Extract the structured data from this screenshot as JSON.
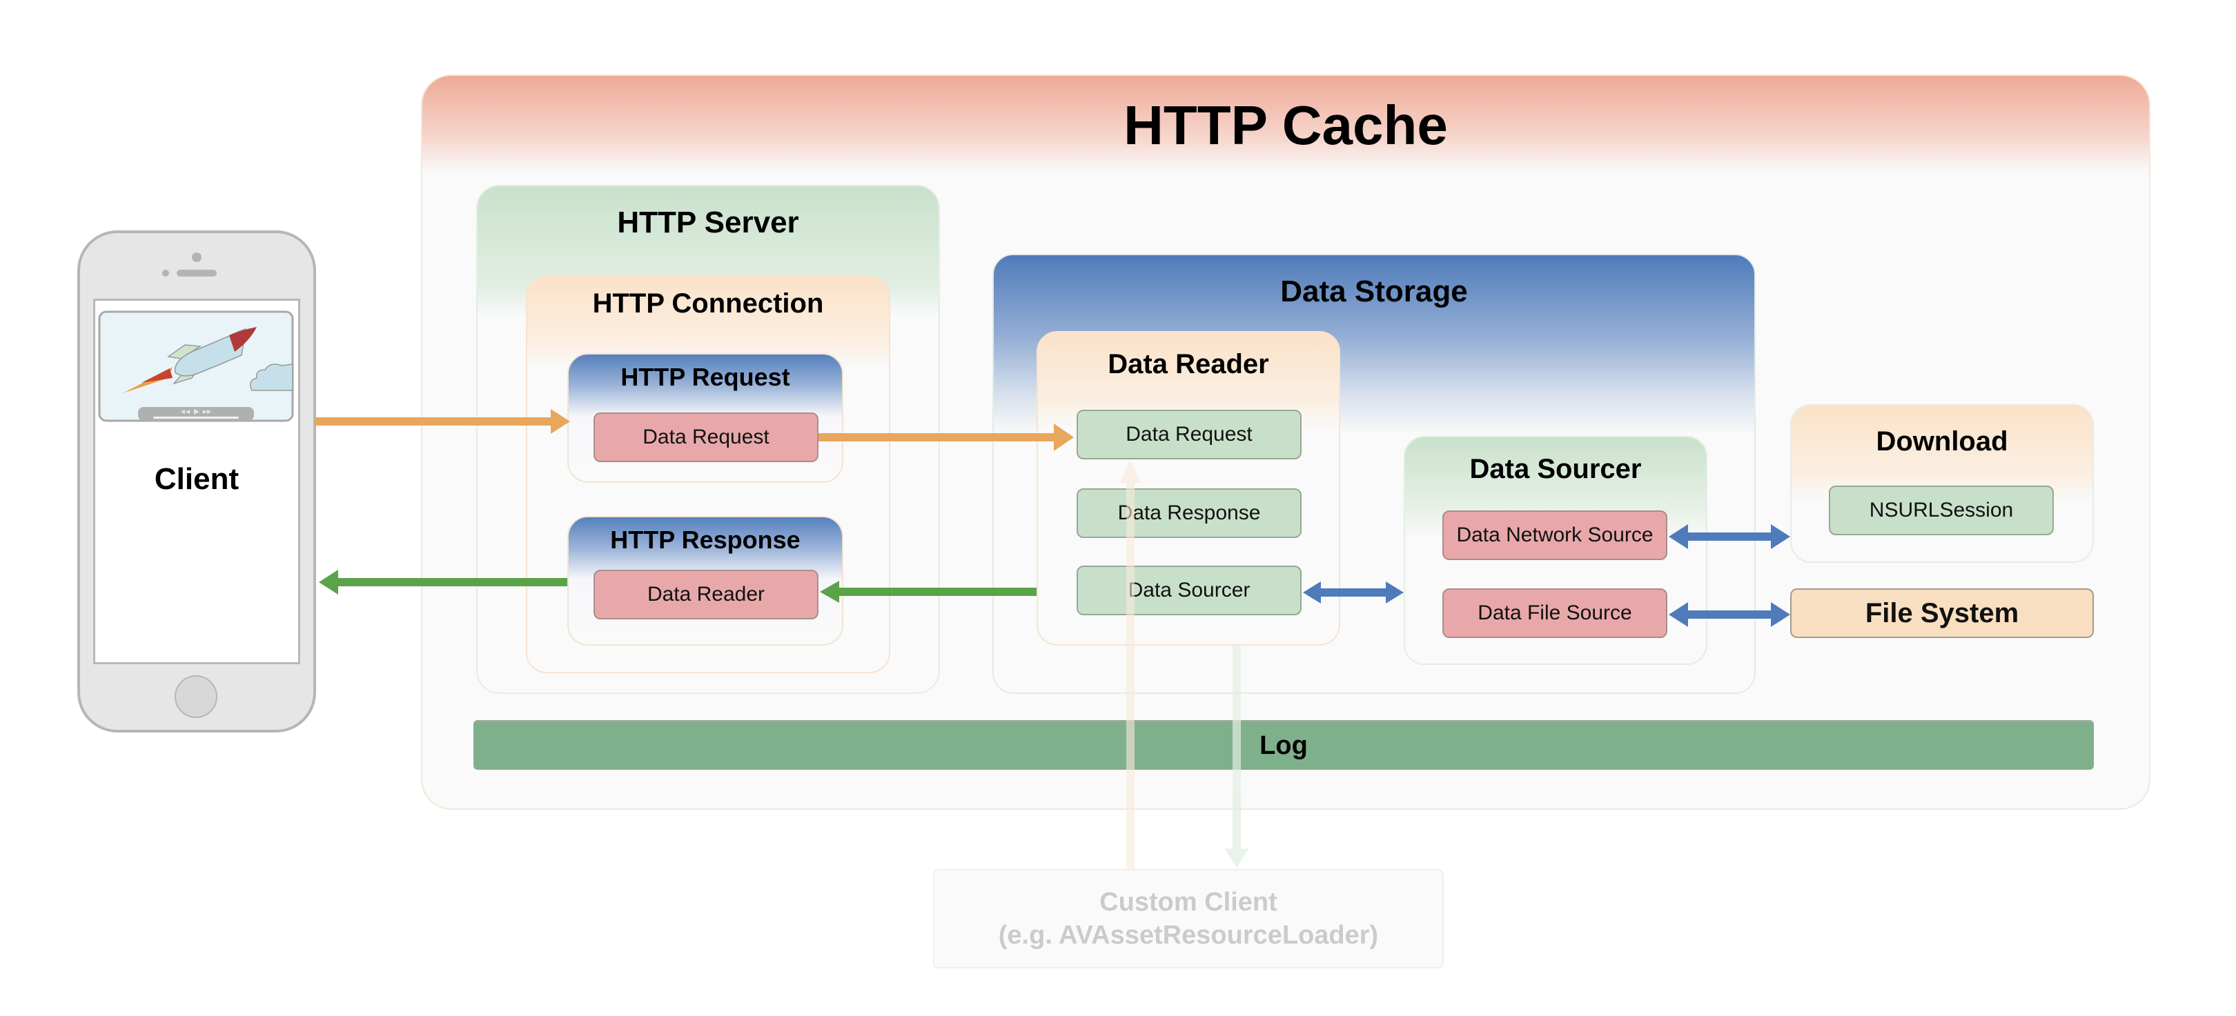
{
  "diagram": {
    "title": "HTTP Cache",
    "client": {
      "label": "Client",
      "video_controls": [
        "rewind",
        "play",
        "fast-forward"
      ]
    },
    "http_server": {
      "title": "HTTP Server",
      "http_connection": {
        "title": "HTTP Connection",
        "http_request": {
          "title": "HTTP Request",
          "item": "Data Request"
        },
        "http_response": {
          "title": "HTTP Response",
          "item": "Data Reader"
        }
      }
    },
    "data_storage": {
      "title": "Data Storage",
      "data_reader": {
        "title": "Data Reader",
        "items": [
          "Data Request",
          "Data Response",
          "Data Sourcer"
        ]
      },
      "data_sourcer": {
        "title": "Data Sourcer",
        "items": [
          "Data Network Source",
          "Data File Source"
        ]
      }
    },
    "download": {
      "title": "Download",
      "item": "NSURLSession"
    },
    "file_system": {
      "label": "File System"
    },
    "log": {
      "label": "Log"
    },
    "custom_client": {
      "line1": "Custom Client",
      "line2": "(e.g. AVAssetResourceLoader)"
    },
    "colors": {
      "request_arrow": "#e8a75a",
      "response_arrow": "#5aa348",
      "bidirectional_arrow": "#4f7bbb",
      "pink_item": "#e8a8a9",
      "green_item": "#c8e0c9",
      "log_bar": "#7fb08c",
      "cache_header": "#eeaa98"
    },
    "connections": [
      {
        "from": "client",
        "to": "http-request",
        "type": "request"
      },
      {
        "from": "http-request.data-request",
        "to": "data-reader.data-request",
        "type": "request"
      },
      {
        "from": "data-reader",
        "to": "http-response.data-reader",
        "type": "response"
      },
      {
        "from": "http-response",
        "to": "client",
        "type": "response"
      },
      {
        "from": "data-reader.data-sourcer",
        "to": "data-sourcer",
        "type": "bidirectional"
      },
      {
        "from": "data-network-source",
        "to": "download",
        "type": "bidirectional"
      },
      {
        "from": "data-file-source",
        "to": "file-system",
        "type": "bidirectional"
      },
      {
        "from": "custom-client",
        "to": "data-reader.data-request",
        "type": "faded-request"
      },
      {
        "from": "data-reader",
        "to": "custom-client",
        "type": "faded-response"
      }
    ]
  }
}
